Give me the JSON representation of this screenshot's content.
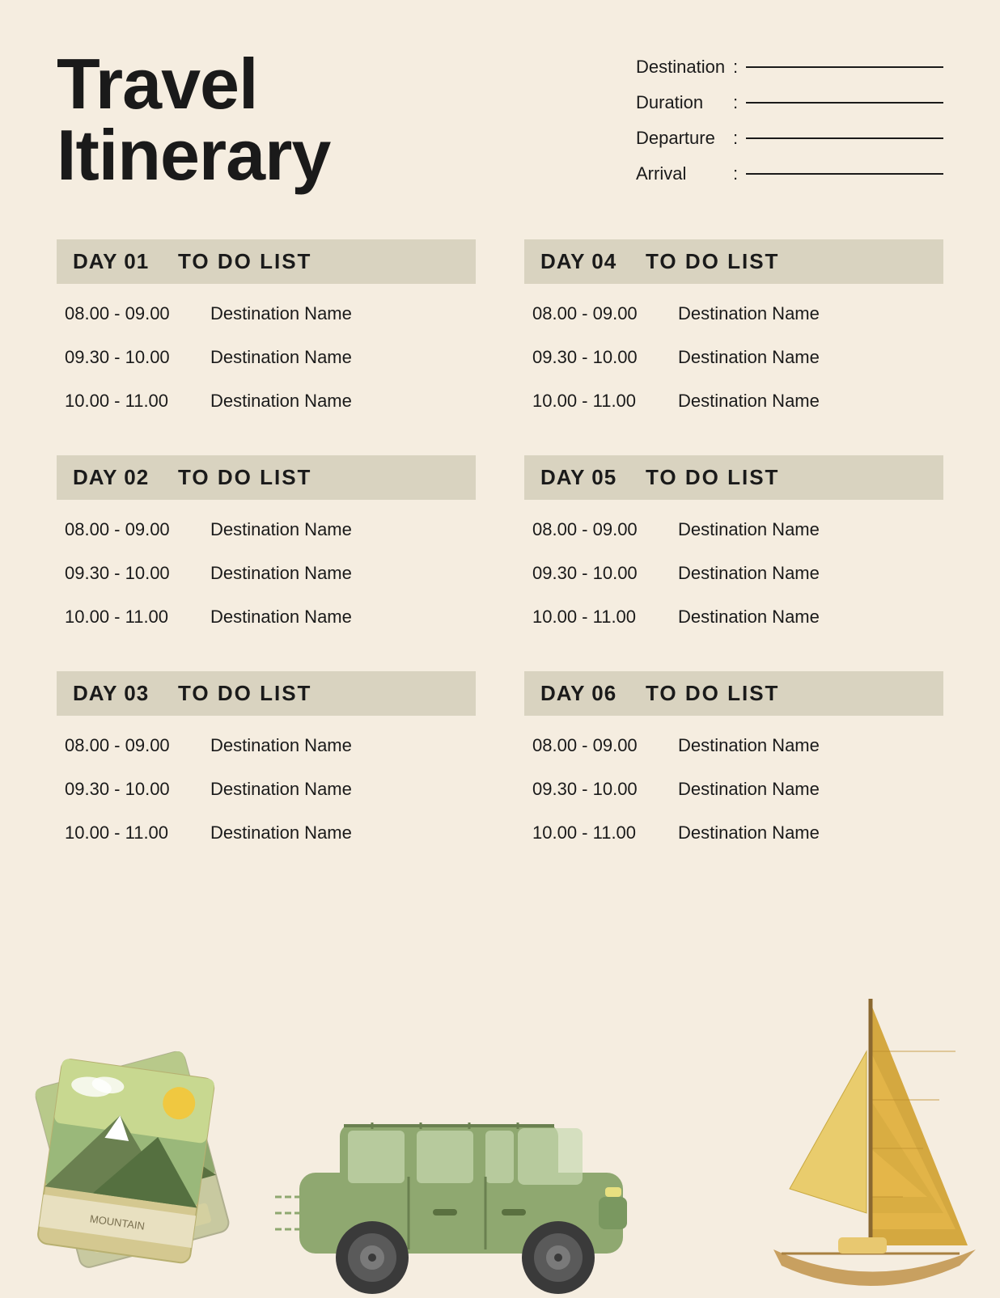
{
  "header": {
    "title_line1": "Travel",
    "title_line2": "Itinerary",
    "fields": {
      "destination_label": "Destination",
      "duration_label": "Duration",
      "departure_label": "Departure",
      "arrival_label": "Arrival",
      "colon": ":"
    }
  },
  "days": [
    {
      "id": "day01",
      "label": "DAY 01",
      "todo": "TO DO LIST",
      "items": [
        {
          "time": "08.00 - 09.00",
          "dest": "Destination Name"
        },
        {
          "time": "09.30 - 10.00",
          "dest": "Destination Name"
        },
        {
          "time": "10.00 - 11.00",
          "dest": "Destination Name"
        }
      ]
    },
    {
      "id": "day04",
      "label": "DAY 04",
      "todo": "TO DO LIST",
      "items": [
        {
          "time": "08.00 - 09.00",
          "dest": "Destination Name"
        },
        {
          "time": "09.30 - 10.00",
          "dest": "Destination Name"
        },
        {
          "time": "10.00 - 11.00",
          "dest": "Destination Name"
        }
      ]
    },
    {
      "id": "day02",
      "label": "DAY 02",
      "todo": "TO DO LIST",
      "items": [
        {
          "time": "08.00 - 09.00",
          "dest": "Destination Name"
        },
        {
          "time": "09.30 - 10.00",
          "dest": "Destination Name"
        },
        {
          "time": "10.00 - 11.00",
          "dest": "Destination Name"
        }
      ]
    },
    {
      "id": "day05",
      "label": "DAY 05",
      "todo": "TO DO LIST",
      "items": [
        {
          "time": "08.00 - 09.00",
          "dest": "Destination Name"
        },
        {
          "time": "09.30 - 10.00",
          "dest": "Destination Name"
        },
        {
          "time": "10.00 - 11.00",
          "dest": "Destination Name"
        }
      ]
    },
    {
      "id": "day03",
      "label": "DAY 03",
      "todo": "TO DO LIST",
      "items": [
        {
          "time": "08.00 - 09.00",
          "dest": "Destination Name"
        },
        {
          "time": "09.30 - 10.00",
          "dest": "Destination Name"
        },
        {
          "time": "10.00 - 11.00",
          "dest": "Destination Name"
        }
      ]
    },
    {
      "id": "day06",
      "label": "DAY 06",
      "todo": "TO DO LIST",
      "items": [
        {
          "time": "08.00 - 09.00",
          "dest": "Destination Name"
        },
        {
          "time": "09.30 - 10.00",
          "dest": "Destination Name"
        },
        {
          "time": "10.00 - 11.00",
          "dest": "Destination Name"
        }
      ]
    }
  ],
  "colors": {
    "background": "#f5ede0",
    "day_header_bg": "#d9d3c0",
    "text_dark": "#1a1a1a"
  }
}
